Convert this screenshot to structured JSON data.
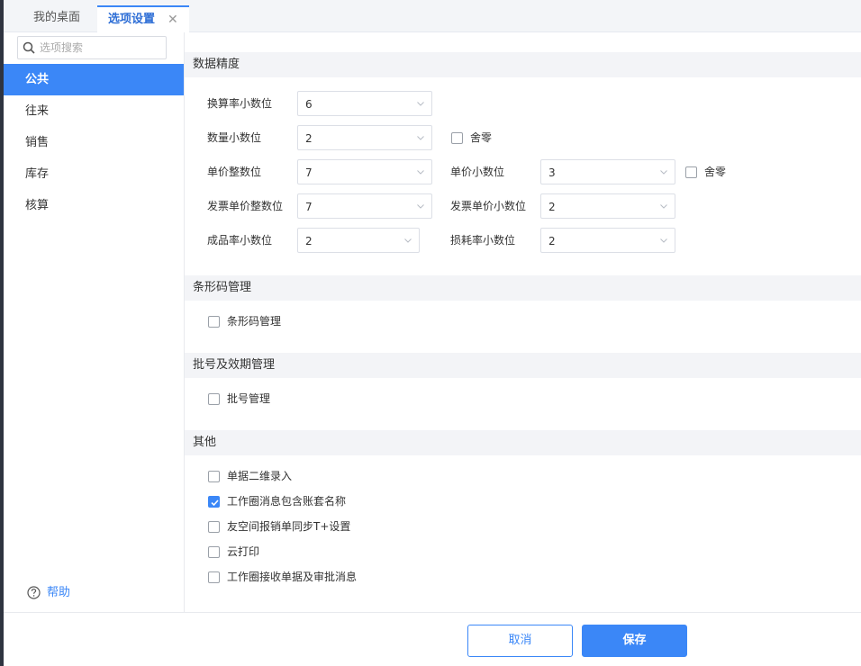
{
  "tabs": [
    {
      "label": "我的桌面"
    },
    {
      "label": "选项设置",
      "close": "✕"
    }
  ],
  "sidebar": {
    "search_placeholder": "选项搜索",
    "items": [
      {
        "label": "公共",
        "active": true
      },
      {
        "label": "往来"
      },
      {
        "label": "销售"
      },
      {
        "label": "库存"
      },
      {
        "label": "核算"
      }
    ],
    "help_label": "帮助"
  },
  "sections": {
    "precision": {
      "title": "数据精度",
      "exchange_rate_decimals": {
        "label": "换算率小数位",
        "value": "6"
      },
      "quantity_decimals": {
        "label": "数量小数位",
        "value": "2",
        "round_off_label": "舍零",
        "round_off_checked": false
      },
      "unit_price_integer": {
        "label": "单价整数位",
        "value": "7"
      },
      "unit_price_decimals": {
        "label": "单价小数位",
        "value": "3",
        "round_off_label": "舍零",
        "round_off_checked": false
      },
      "invoice_price_integer": {
        "label": "发票单价整数位",
        "value": "7"
      },
      "invoice_price_decimals": {
        "label": "发票单价小数位",
        "value": "2"
      },
      "yield_rate_decimals": {
        "label": "成品率小数位",
        "value": "2"
      },
      "loss_rate_decimals": {
        "label": "损耗率小数位",
        "value": "2"
      }
    },
    "barcode": {
      "title": "条形码管理",
      "options": [
        {
          "label": "条形码管理",
          "checked": false
        }
      ]
    },
    "batch": {
      "title": "批号及效期管理",
      "options": [
        {
          "label": "批号管理",
          "checked": false
        }
      ]
    },
    "other": {
      "title": "其他",
      "options": [
        {
          "label": "单据二维录入",
          "checked": false
        },
        {
          "label": "工作圈消息包含账套名称",
          "checked": true
        },
        {
          "label": "友空间报销单同步T+设置",
          "checked": false
        },
        {
          "label": "云打印",
          "checked": false
        },
        {
          "label": "工作圈接收单据及审批消息",
          "checked": false
        }
      ]
    }
  },
  "footer": {
    "cancel_label": "取消",
    "save_label": "保存"
  },
  "colors": {
    "accent": "#3b87f7",
    "sidebar_strip": "#2f3440",
    "section_bg": "#f3f4f7"
  },
  "icons": {
    "search": "search-icon",
    "help": "help-circle-icon",
    "dropdown": "chevron-down-icon",
    "close": "close-icon",
    "check": "check-icon"
  }
}
